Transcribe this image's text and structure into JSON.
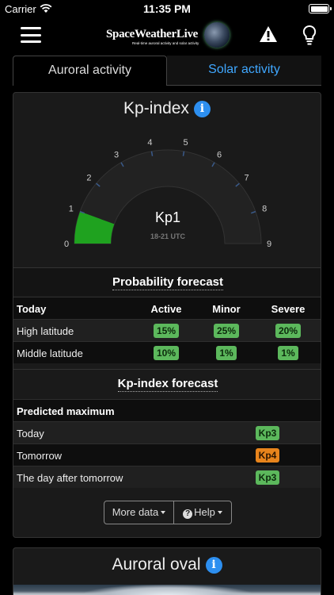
{
  "status_bar": {
    "carrier": "Carrier",
    "time": "11:35 PM"
  },
  "navbar": {
    "logo_text": "SpaceWeatherLive",
    "logo_tagline": "Real-time auroral activity and solar activity"
  },
  "tabs": [
    {
      "label": "Auroral activity",
      "active": true
    },
    {
      "label": "Solar activity",
      "active": false
    }
  ],
  "kp_card": {
    "title": "Kp-index",
    "info_glyph": "i",
    "gauge": {
      "value": 1,
      "min": 0,
      "max": 9,
      "display": "Kp1",
      "time_range": "18-21 UTC",
      "fill_color": "#1fa21f",
      "ticks": [
        "0",
        "1",
        "2",
        "3",
        "4",
        "5",
        "6",
        "7",
        "8",
        "9"
      ]
    }
  },
  "probability_forecast": {
    "title": "Probability forecast",
    "columns": [
      "Today",
      "Active",
      "Minor",
      "Severe"
    ],
    "rows": [
      {
        "label": "High latitude",
        "values": [
          "15%",
          "25%",
          "20%"
        ]
      },
      {
        "label": "Middle latitude",
        "values": [
          "10%",
          "1%",
          "1%"
        ]
      }
    ]
  },
  "kp_forecast": {
    "title": "Kp-index forecast",
    "subheader": "Predicted maximum",
    "rows": [
      {
        "label": "Today",
        "value": "Kp3",
        "color": "green"
      },
      {
        "label": "Tomorrow",
        "value": "Kp4",
        "color": "orange"
      },
      {
        "label": "The day after tomorrow",
        "value": "Kp3",
        "color": "green"
      }
    ]
  },
  "buttons": {
    "more_data": "More data",
    "help": "Help"
  },
  "auroral_oval": {
    "title": "Auroral oval",
    "info_glyph": "i"
  },
  "colors": {
    "accent_blue": "#3fa7ff",
    "badge_green": "#5cb85c",
    "badge_orange": "#e8841c"
  }
}
